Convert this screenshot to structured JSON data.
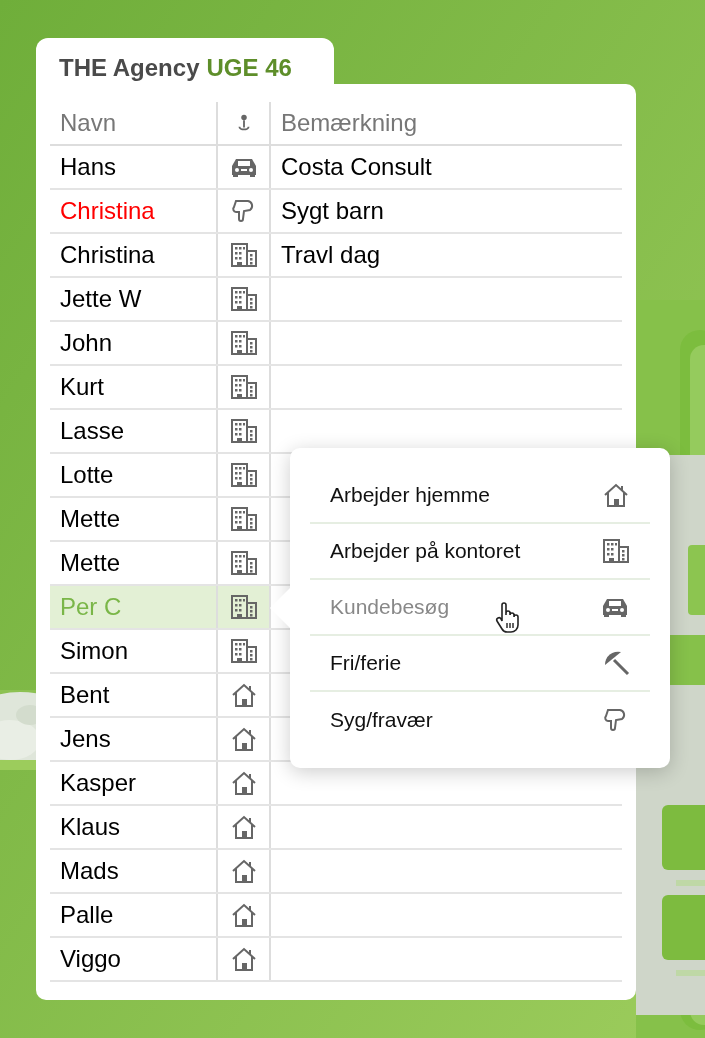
{
  "header": {
    "title": "THE Agency",
    "week": "UGE 46"
  },
  "table": {
    "columns": [
      {
        "label": "Navn"
      },
      {
        "kind": "pin"
      },
      {
        "label": "Bemærkning"
      }
    ],
    "rows": [
      {
        "name": "Hans",
        "color": "#000000",
        "kind": "car",
        "remark": "Costa Consult",
        "selected": false
      },
      {
        "name": "Christina",
        "color": "#ff0000",
        "kind": "sick",
        "remark": "Sygt barn",
        "selected": false
      },
      {
        "name": "Christina",
        "color": "#000000",
        "kind": "office",
        "remark": "Travl dag",
        "selected": false
      },
      {
        "name": "Jette W",
        "color": "#000000",
        "kind": "office",
        "selected": false
      },
      {
        "name": "John",
        "color": "#000000",
        "kind": "office",
        "selected": false
      },
      {
        "name": "Kurt",
        "color": "#000000",
        "kind": "office",
        "selected": false
      },
      {
        "name": "Lasse",
        "color": "#000000",
        "kind": "office",
        "selected": false
      },
      {
        "name": "Lotte",
        "color": "#000000",
        "kind": "office",
        "selected": false
      },
      {
        "name": "Mette",
        "color": "#000000",
        "kind": "office",
        "selected": false
      },
      {
        "name": "Mette",
        "color": "#000000",
        "kind": "office",
        "selected": false
      },
      {
        "name": "Per C",
        "color": "#7ab648",
        "kind": "office",
        "selected": true
      },
      {
        "name": "Simon",
        "color": "#000000",
        "kind": "office",
        "selected": false
      },
      {
        "name": "Bent",
        "color": "#000000",
        "kind": "home",
        "selected": false
      },
      {
        "name": "Jens",
        "color": "#000000",
        "kind": "home",
        "selected": false
      },
      {
        "name": "Kasper",
        "color": "#000000",
        "kind": "home",
        "selected": false
      },
      {
        "name": "Klaus",
        "color": "#000000",
        "kind": "home",
        "selected": false
      },
      {
        "name": "Mads",
        "color": "#000000",
        "kind": "home",
        "selected": false
      },
      {
        "name": "Palle",
        "color": "#000000",
        "kind": "home",
        "selected": false
      },
      {
        "name": "Viggo",
        "color": "#000000",
        "kind": "home",
        "selected": false
      }
    ]
  },
  "menu": {
    "items": [
      {
        "label": "Arbejder hjemme",
        "kind": "home",
        "hovered": false
      },
      {
        "label": "Arbejder på kontoret",
        "kind": "office",
        "hovered": false
      },
      {
        "label": "Kundebesøg",
        "kind": "car",
        "hovered": true
      },
      {
        "label": "Fri/ferie",
        "kind": "umbrella",
        "hovered": false
      },
      {
        "label": "Syg/fravær",
        "kind": "sick",
        "hovered": false
      }
    ]
  }
}
